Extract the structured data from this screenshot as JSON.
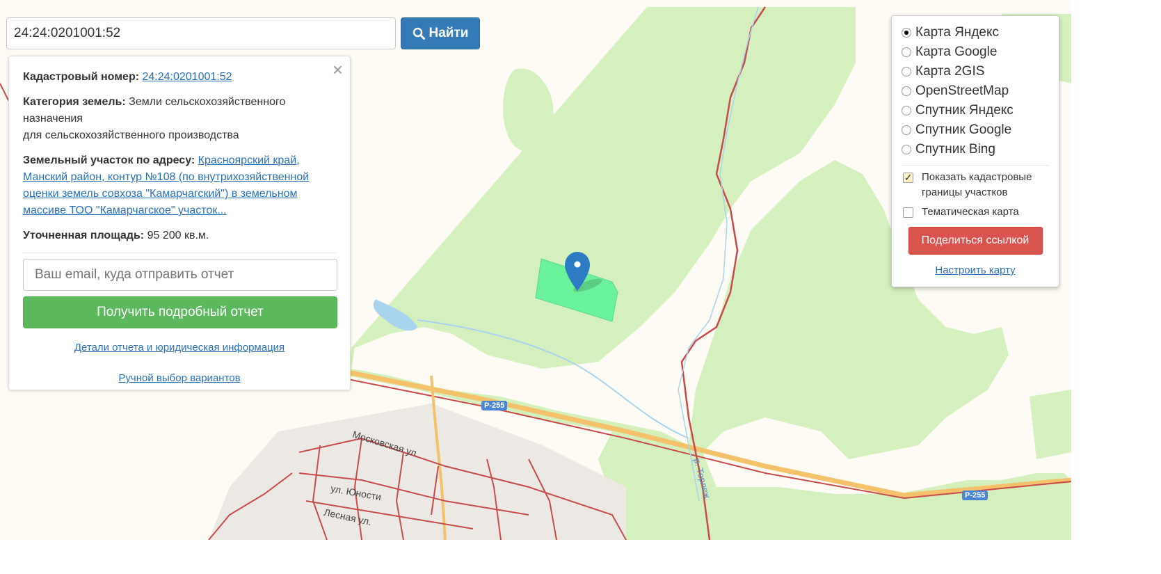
{
  "search": {
    "value": "24:24:0201001:52",
    "button": "Найти"
  },
  "info": {
    "close": "×",
    "cadastral_label": "Кадастровый номер:",
    "cadastral_value": "24:24:0201001:52",
    "category_label": "Категория земель:",
    "category_value": "Земли сельскохозяйственного назначения",
    "category_use": "для сельскохозяйственного производства",
    "address_label": "Земельный участок по адресу:",
    "address_value": "Красноярский край, Манский район, контур №108 (по внутрихозяйственной оценки земель совхоза \"Камарчагский\") в земельном массиве ТОО \"Камарчагское\" участок...",
    "area_label": "Уточненная площадь:",
    "area_value": "95 200 кв.м.",
    "email_placeholder": "Ваш email, куда отправить отчет",
    "report_button": "Получить подробный отчет",
    "details_link": "Детали отчета и юридическая информация",
    "manual_link": "Ручной выбор вариантов"
  },
  "layers": {
    "options": [
      {
        "label": "Карта Яндекс",
        "selected": true
      },
      {
        "label": "Карта Google",
        "selected": false
      },
      {
        "label": "Карта 2GIS",
        "selected": false
      },
      {
        "label": "OpenStreetMap",
        "selected": false
      },
      {
        "label": "Спутник Яндекс",
        "selected": false
      },
      {
        "label": "Спутник Google",
        "selected": false
      },
      {
        "label": "Спутник Bing",
        "selected": false
      }
    ],
    "show_cadastral": "Показать кадастровые границы участков",
    "show_cadastral_checked": true,
    "thematic": "Тематическая карта",
    "thematic_checked": false,
    "share_button": "Поделиться ссылкой",
    "setup_link": "Настроить карту"
  },
  "map": {
    "road_badge_1": "P-255",
    "road_badge_2": "P-255",
    "street_1": "Московская ул.",
    "street_2": "ул. Юности",
    "street_3": "Лесная ул.",
    "river": "р. Терлеж",
    "colors": {
      "forest": "#d4f0bc",
      "parcel": "#6af29a",
      "road": "#f5c26b",
      "border": "#c94a4a",
      "water": "#a8d4f0"
    }
  }
}
